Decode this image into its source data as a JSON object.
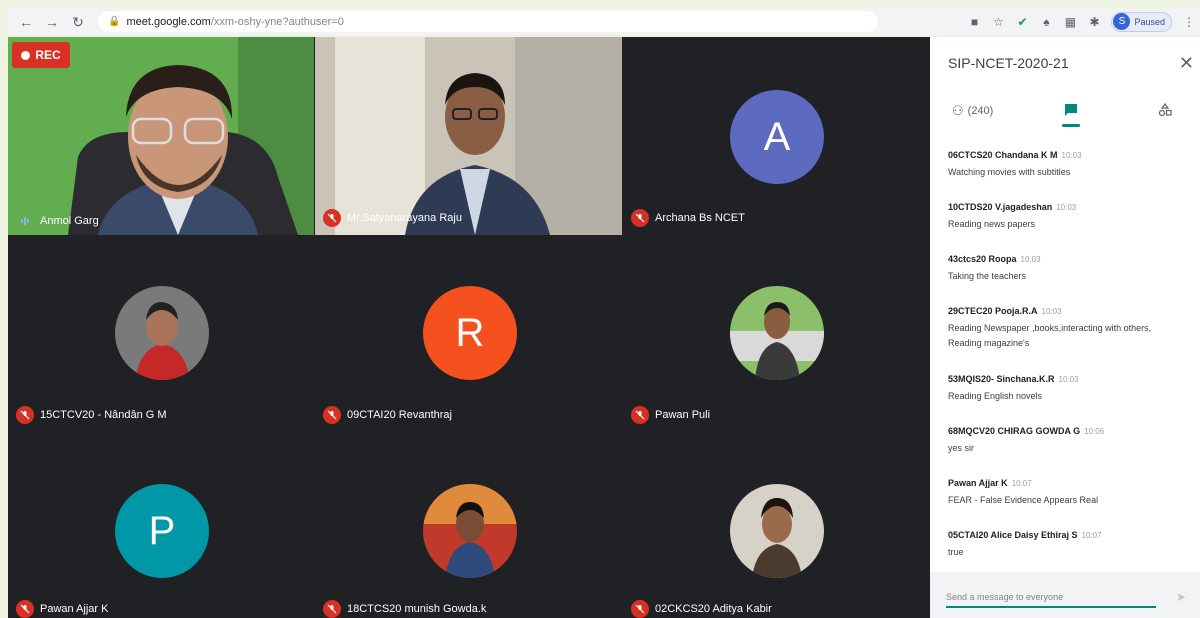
{
  "browser": {
    "url_host": "meet.google.com",
    "url_path": "/xxm-oshy-yne?authuser=0",
    "profile_initial": "S",
    "profile_status": "Paused"
  },
  "recording": {
    "label": "REC"
  },
  "participants": [
    {
      "name": "Anmol Garg"
    },
    {
      "name": "Mr.Satyanarayana Raju"
    },
    {
      "name": "Archana Bs NCET",
      "initial": "A",
      "color": "#5c6bc0"
    },
    {
      "name": "15CTCV20 - Nândân G M"
    },
    {
      "name": "09CTAI20 Revanthraj",
      "initial": "R",
      "color": "#f4511e"
    },
    {
      "name": "Pawan Puli"
    },
    {
      "name": "Pawan Ajjar K",
      "initial": "P",
      "color": "#0097a7"
    },
    {
      "name": "18CTCS20 munish Gowda.k"
    },
    {
      "name": "02CKCS20 Aditya Kabir"
    }
  ],
  "panel": {
    "title": "SIP-NCET-2020-21",
    "people_count": "(240)",
    "messages": [
      {
        "sender": "06CTCS20 Chandana K M",
        "time": "10:03",
        "lines": [
          "Watching movies with subtitles"
        ]
      },
      {
        "sender": "10CTDS20 V.jagadeshan",
        "time": "10:03",
        "lines": [
          "Reading news papers"
        ]
      },
      {
        "sender": "43ctcs20 Roopa",
        "time": "10:03",
        "lines": [
          "Taking the teachers"
        ]
      },
      {
        "sender": "29CTEC20 Pooja.R.A",
        "time": "10:03",
        "lines": [
          "Reading Newspaper ,books,interacting with others,",
          "Reading magazine's"
        ]
      },
      {
        "sender": "53MQIS20- Sinchana.K.R",
        "time": "10:03",
        "lines": [
          "Reading English novels"
        ]
      },
      {
        "sender": "68MQCV20 CHIRAG GOWDA G",
        "time": "10:06",
        "lines": [
          "yes sir"
        ]
      },
      {
        "sender": "Pawan Ajjar K",
        "time": "10:07",
        "lines": [
          "FEAR - False Evidence Appears Real"
        ]
      },
      {
        "sender": "05CTAI20 Alice Daisy Ethiraj S",
        "time": "10:07",
        "lines": [
          "true"
        ]
      }
    ],
    "composer_placeholder": "Send a message to everyone"
  },
  "icons": {
    "back": "arrow-left-icon",
    "forward": "arrow-right-icon",
    "reload": "reload-icon",
    "lock": "lock-icon",
    "close": "close-icon",
    "people": "people-icon",
    "chat": "chat-icon",
    "activities": "shapes-icon",
    "send": "send-icon",
    "mic_off": "mic-off-icon"
  }
}
